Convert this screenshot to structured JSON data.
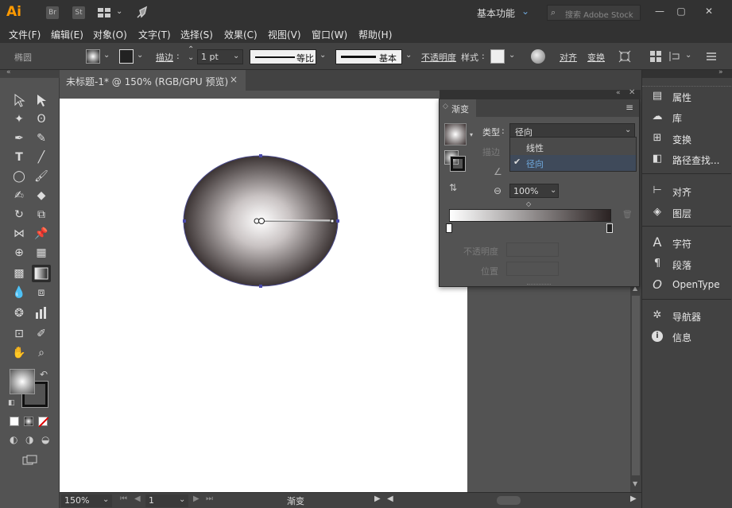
{
  "app": {
    "logo": "Ai",
    "workspace": "基本功能",
    "search_placeholder": "搜索 Adobe Stock",
    "icons": [
      "br-icon",
      "st-icon",
      "layout-icon",
      "rocket-icon"
    ]
  },
  "menu": [
    "文件(F)",
    "编辑(E)",
    "对象(O)",
    "文字(T)",
    "选择(S)",
    "效果(C)",
    "视图(V)",
    "窗口(W)",
    "帮助(H)"
  ],
  "control": {
    "object_type": "椭圆",
    "stroke_label": "描边",
    "stroke_value": "1 pt",
    "profile_label": "等比",
    "brush_label": "基本",
    "opacity_label": "不透明度",
    "style_label": "样式",
    "align_label": "对齐",
    "transform_label": "变换"
  },
  "document": {
    "tab_title": "未标题-1* @ 150% (RGB/GPU 预览)",
    "close": "×"
  },
  "gradient_panel": {
    "title": "渐变",
    "type_label": "类型",
    "type_value": "径向",
    "stroke_label": "描边",
    "aspect_value": "100%",
    "opacity_label": "不透明度",
    "location_label": "位置",
    "type_options": [
      "线性",
      "径向"
    ],
    "selected_option": "径向"
  },
  "status": {
    "zoom": "150%",
    "page": "1",
    "tool": "渐变"
  },
  "dock": [
    {
      "label": "属性",
      "icon": "properties-icon",
      "glyph": "▤"
    },
    {
      "label": "库",
      "icon": "libraries-icon",
      "glyph": "☁"
    },
    {
      "label": "变换",
      "icon": "transform-icon",
      "glyph": "⊞"
    },
    {
      "label": "路径查找...",
      "icon": "pathfinder-icon",
      "glyph": "◧"
    },
    {
      "label": "对齐",
      "icon": "align-icon",
      "glyph": "⊢"
    },
    {
      "label": "图层",
      "icon": "layers-icon",
      "glyph": "◈"
    },
    {
      "label": "字符",
      "icon": "character-icon",
      "glyph": "A"
    },
    {
      "label": "段落",
      "icon": "paragraph-icon",
      "glyph": "¶"
    },
    {
      "label": "OpenType",
      "icon": "opentype-icon",
      "glyph": "O"
    },
    {
      "label": "导航器",
      "icon": "navigator-icon",
      "glyph": "✲"
    },
    {
      "label": "信息",
      "icon": "info-icon",
      "glyph": "i"
    }
  ],
  "colors": {
    "accent": "#6fa8dc",
    "panel": "#535353",
    "chrome": "#323232",
    "artboard": "#ffffff",
    "gradient_start": "#ffffff",
    "gradient_end": "#2a2222"
  }
}
